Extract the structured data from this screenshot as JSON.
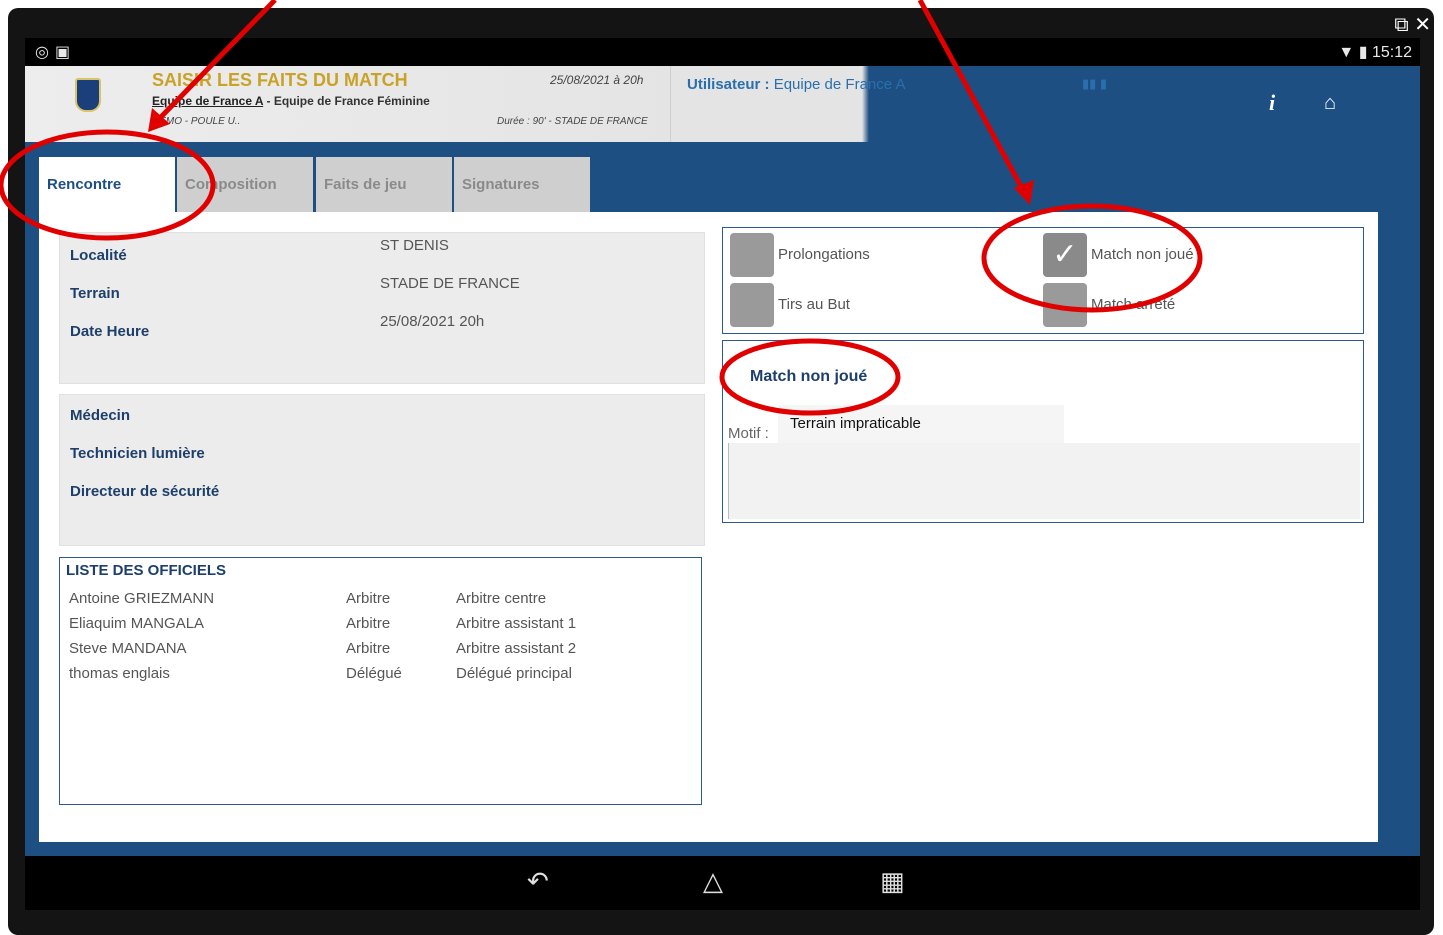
{
  "window_controls": {
    "popout_icon": "external-icon",
    "close_icon": "close-icon"
  },
  "status_bar": {
    "time": "15:12",
    "left_icons": "eye-icon, vpn-icon"
  },
  "header": {
    "title": "SAISIR LES FAITS DU MATCH",
    "home_team": "Equipe de France A",
    "separator": " - ",
    "away_team": "Equipe de France Féminine",
    "competition": "DEMO - POULE U..",
    "date": "25/08/2021 à 20h",
    "duration": "Durée : 90' - STADE DE FRANCE",
    "user_label": "Utilisateur :",
    "user_value": "Equipe de France A",
    "info_label": "i"
  },
  "tabs": [
    {
      "label": "Rencontre"
    },
    {
      "label": "Composition"
    },
    {
      "label": "Faits de jeu"
    },
    {
      "label": "Signatures"
    }
  ],
  "match_info": {
    "localite_label": "Localité",
    "localite_value": "ST DENIS",
    "terrain_label": "Terrain",
    "terrain_value": "STADE DE FRANCE",
    "date_label": "Date Heure",
    "date_value": "25/08/2021 20h"
  },
  "staff": {
    "medecin_label": "Médecin",
    "technicien_label": "Technicien lumière",
    "directeur_label": "Directeur de sécurité"
  },
  "officials": {
    "title": "LISTE DES OFFICIELS",
    "rows": [
      {
        "name": "Antoine GRIEZMANN",
        "role": "Arbitre",
        "function": "Arbitre centre"
      },
      {
        "name": "Eliaquim MANGALA",
        "role": "Arbitre",
        "function": "Arbitre assistant 1"
      },
      {
        "name": "Steve MANDANA",
        "role": "Arbitre",
        "function": "Arbitre assistant 2"
      },
      {
        "name": "thomas englais",
        "role": "Délégué",
        "function": "Délégué principal"
      }
    ]
  },
  "options": {
    "prolongations": "Prolongations",
    "tirs": "Tirs au But",
    "non_joue": "Match non joué",
    "arrete": "Match arrêté",
    "non_joue_checked": true
  },
  "non_joue_panel": {
    "title": "Match non joué",
    "motif_label": "Motif :",
    "motif_value": "Terrain impraticable"
  }
}
